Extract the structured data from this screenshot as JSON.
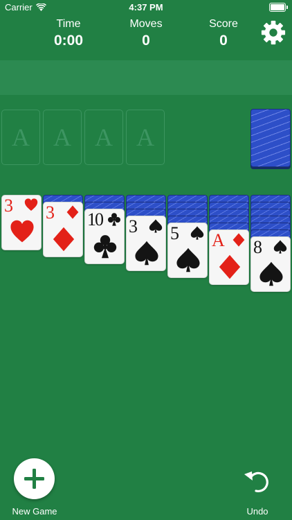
{
  "status_bar": {
    "carrier": "Carrier",
    "time": "4:37 PM"
  },
  "stats": [
    {
      "label": "Time",
      "value": "0:00"
    },
    {
      "label": "Moves",
      "value": "0"
    },
    {
      "label": "Score",
      "value": "0"
    }
  ],
  "foundations": [
    "A",
    "A",
    "A",
    "A"
  ],
  "tableau": [
    {
      "face_down": 0,
      "card": {
        "rank": "3",
        "suit": "heart",
        "color": "red"
      }
    },
    {
      "face_down": 1,
      "card": {
        "rank": "3",
        "suit": "diamond",
        "color": "red"
      }
    },
    {
      "face_down": 2,
      "card": {
        "rank": "10",
        "suit": "club",
        "color": "black"
      }
    },
    {
      "face_down": 3,
      "card": {
        "rank": "3",
        "suit": "spade",
        "color": "black"
      }
    },
    {
      "face_down": 4,
      "card": {
        "rank": "5",
        "suit": "spade",
        "color": "black"
      }
    },
    {
      "face_down": 5,
      "card": {
        "rank": "A",
        "suit": "diamond",
        "color": "red"
      }
    },
    {
      "face_down": 6,
      "card": {
        "rank": "8",
        "suit": "spade",
        "color": "black"
      }
    }
  ],
  "colors": {
    "felt": "#218044",
    "red_suit": "#e32118",
    "card_back": "#2d4fc8"
  },
  "bottom_bar": {
    "new_game_label": "New Game",
    "undo_label": "Undo"
  }
}
